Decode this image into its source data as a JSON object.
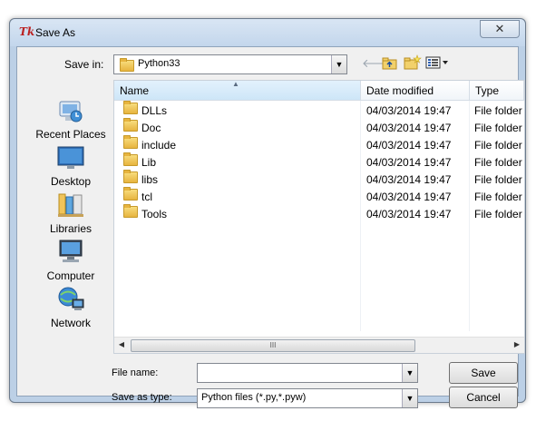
{
  "window": {
    "title": "Save As",
    "close_glyph": "✕"
  },
  "toolbar": {
    "save_in_label": "Save in:",
    "save_in_value": "Python33",
    "back_icon": "back-arrow-icon",
    "up_icon": "up-folder-icon",
    "new_folder_icon": "new-folder-icon",
    "view_menu_icon": "view-menu-icon"
  },
  "places": [
    {
      "label": "Recent Places",
      "icon": "recent-places-icon"
    },
    {
      "label": "Desktop",
      "icon": "desktop-icon"
    },
    {
      "label": "Libraries",
      "icon": "libraries-icon"
    },
    {
      "label": "Computer",
      "icon": "computer-icon"
    },
    {
      "label": "Network",
      "icon": "network-icon"
    }
  ],
  "columns": {
    "name": "Name",
    "date": "Date modified",
    "type": "Type"
  },
  "files": [
    {
      "name": "DLLs",
      "date": "04/03/2014 19:47",
      "type": "File folder"
    },
    {
      "name": "Doc",
      "date": "04/03/2014 19:47",
      "type": "File folder"
    },
    {
      "name": "include",
      "date": "04/03/2014 19:47",
      "type": "File folder"
    },
    {
      "name": "Lib",
      "date": "04/03/2014 19:47",
      "type": "File folder"
    },
    {
      "name": "libs",
      "date": "04/03/2014 19:47",
      "type": "File folder"
    },
    {
      "name": "tcl",
      "date": "04/03/2014 19:47",
      "type": "File folder"
    },
    {
      "name": "Tools",
      "date": "04/03/2014 19:47",
      "type": "File folder"
    }
  ],
  "scroll_grip": "III",
  "form": {
    "file_name_label": "File name:",
    "file_name_value": "",
    "save_type_label": "Save as type:",
    "save_type_value": "Python files (*.py,*.pyw)"
  },
  "buttons": {
    "save": "Save",
    "cancel": "Cancel"
  }
}
